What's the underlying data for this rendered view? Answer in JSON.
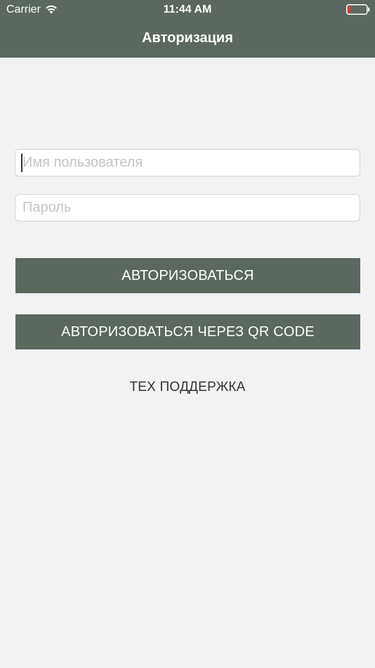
{
  "status_bar": {
    "carrier": "Carrier",
    "time": "11:44 AM",
    "wifi_icon": "wifi-icon",
    "battery_icon": "battery-icon",
    "battery_level_fraction": 0.15,
    "battery_color": "#e53935"
  },
  "nav": {
    "title": "Авторизация"
  },
  "form": {
    "username_placeholder": "Имя пользователя",
    "username_value": "",
    "password_placeholder": "Пароль",
    "password_value": ""
  },
  "actions": {
    "login_label": "АВТОРИЗОВАТЬСЯ",
    "qr_login_label": "АВТОРИЗОВАТЬСЯ ЧЕРЕЗ QR CODE",
    "support_label": "ТЕХ ПОДДЕРЖКА"
  },
  "colors": {
    "primary": "#5b685e",
    "background": "#f2f2f2",
    "text": "#333333"
  }
}
